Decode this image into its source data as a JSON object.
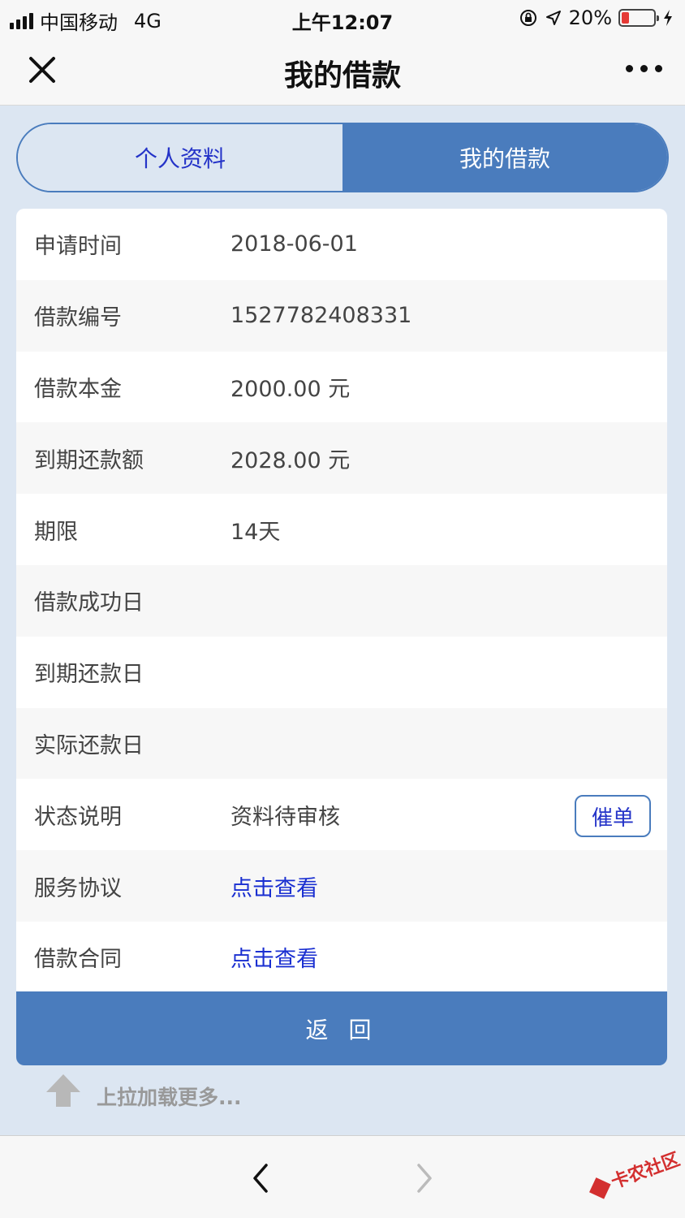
{
  "status_bar": {
    "carrier": "中国移动",
    "network": "4G",
    "time": "上午12:07",
    "battery": "20%",
    "battery_level": 0.2
  },
  "nav": {
    "title": "我的借款"
  },
  "tabs": [
    {
      "label": "个人资料",
      "active": false
    },
    {
      "label": "我的借款",
      "active": true
    }
  ],
  "details": {
    "rows": [
      {
        "label": "申请时间",
        "value": "2018-06-01"
      },
      {
        "label": "借款编号",
        "value": "1527782408331"
      },
      {
        "label": "借款本金",
        "value": "2000.00 元"
      },
      {
        "label": "到期还款额",
        "value": "2028.00 元"
      },
      {
        "label": "期限",
        "value": "14天"
      },
      {
        "label": "借款成功日",
        "value": ""
      },
      {
        "label": "到期还款日",
        "value": ""
      },
      {
        "label": "实际还款日",
        "value": ""
      },
      {
        "label": "状态说明",
        "value": "资料待审核",
        "button": "催单"
      },
      {
        "label": "服务协议",
        "value": "点击查看",
        "link": true
      },
      {
        "label": "借款合同",
        "value": "点击查看",
        "link": true
      }
    ]
  },
  "back_button": "返 回",
  "load_more": "上拉加载更多...",
  "watermark": "卡农社区",
  "colors": {
    "primary": "#4a7cbd",
    "link": "#1a2fd1",
    "page_bg": "#dce6f2"
  }
}
